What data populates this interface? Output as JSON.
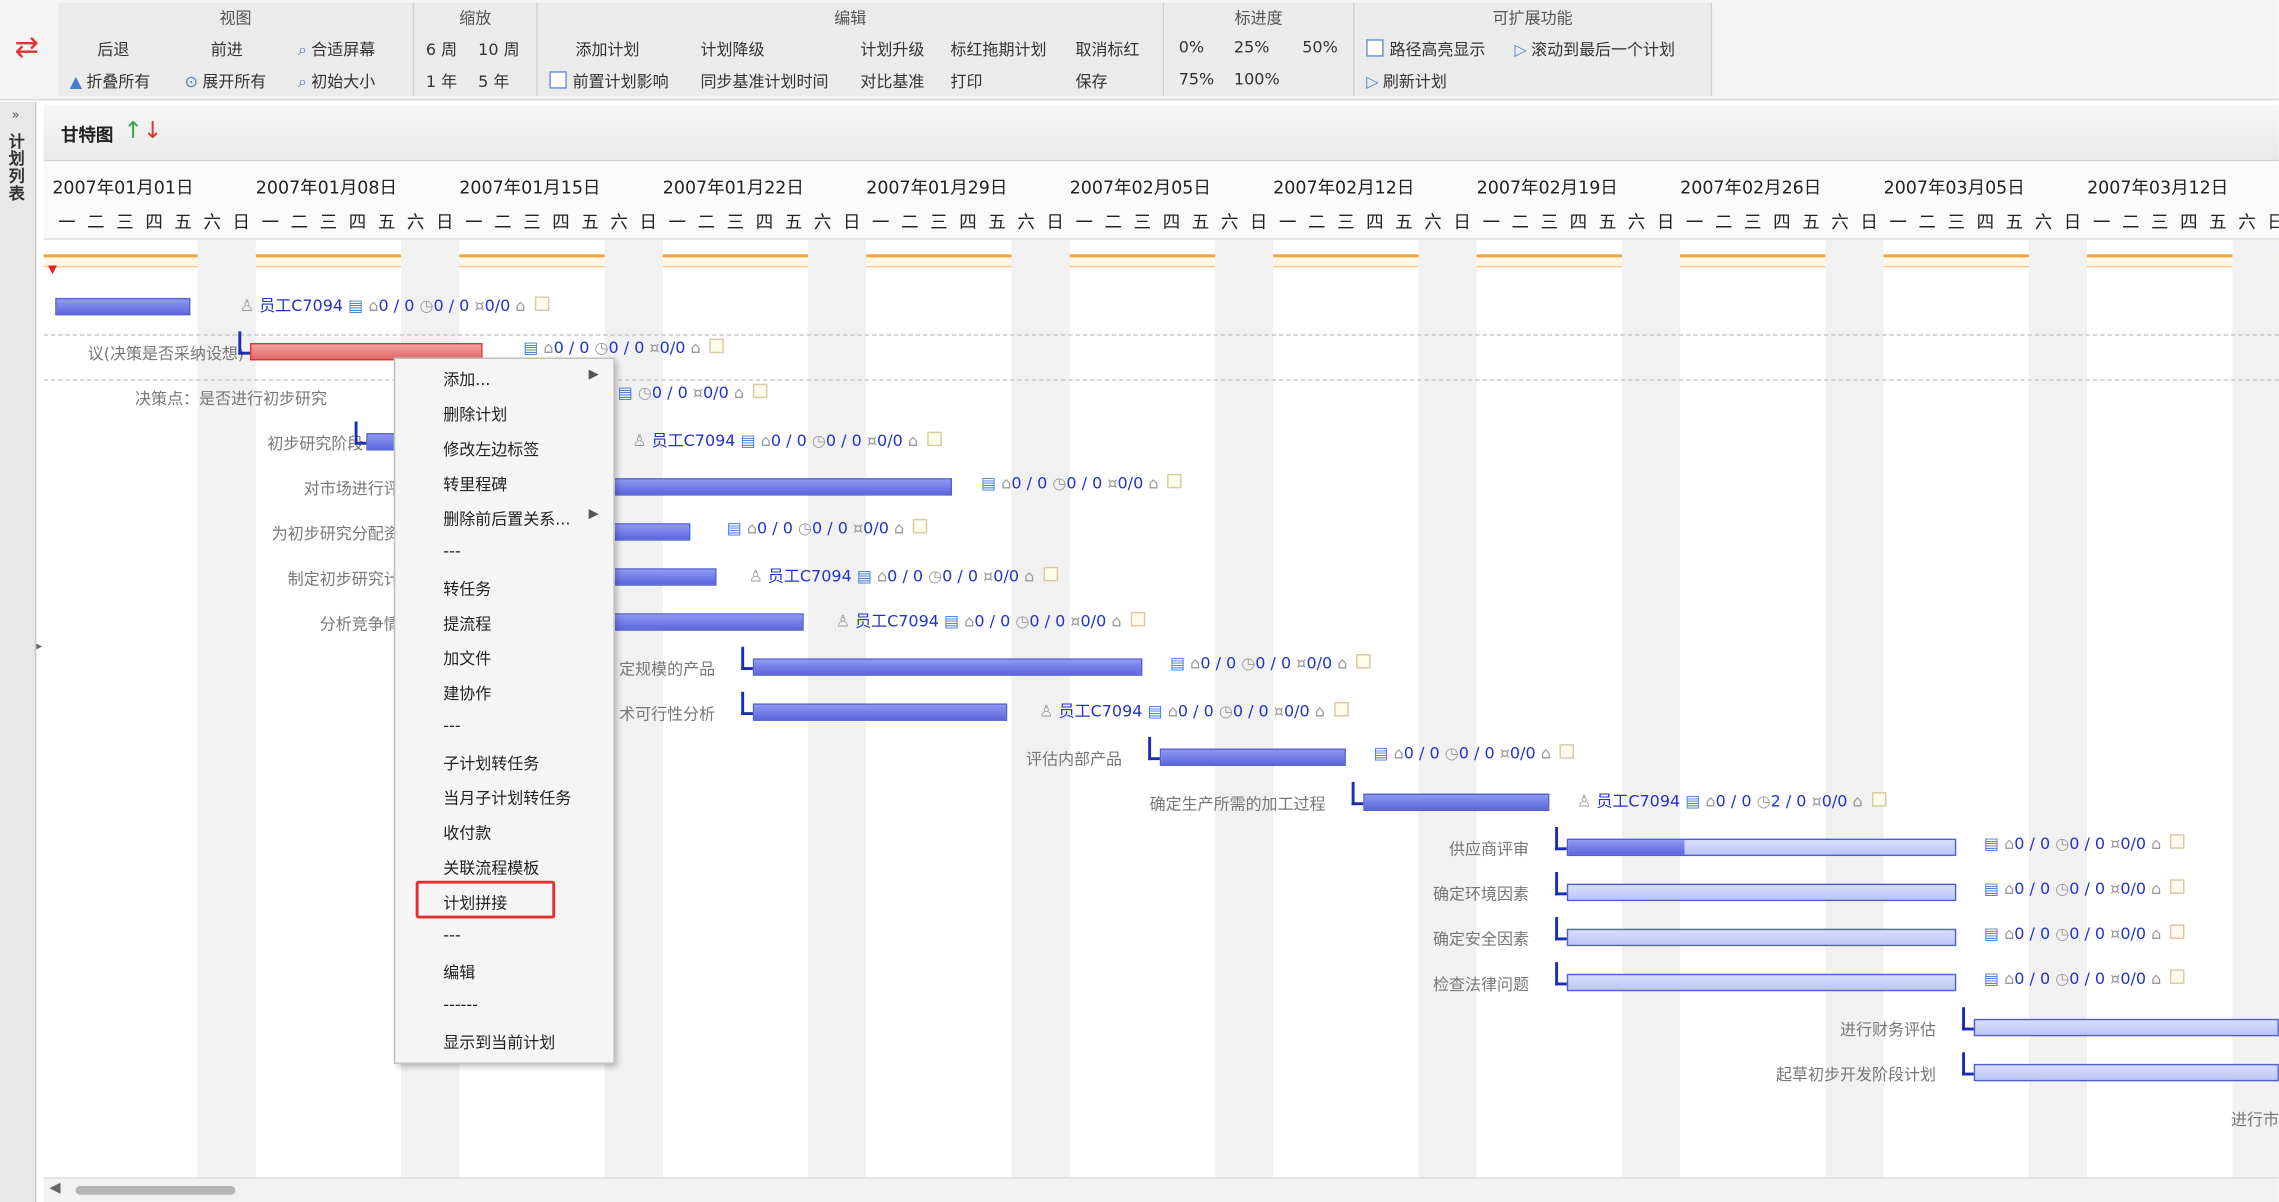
{
  "toolbar": {
    "groups": {
      "view": "视图",
      "zoom": "缩放",
      "edit": "编辑",
      "progress": "标进度",
      "ext": "可扩展功能"
    },
    "view": {
      "back": "后退",
      "forward": "前进",
      "fit": "合适屏幕",
      "collapse": "折叠所有",
      "expand": "展开所有",
      "init": "初始大小"
    },
    "zoom": {
      "w6": "6 周",
      "w10": "10 周",
      "y1": "1 年",
      "y5": "5 年"
    },
    "edit": {
      "add": "添加计划",
      "demote": "计划降级",
      "upgrade": "计划升级",
      "drag": "标红拖期计划",
      "unmark": "取消标红",
      "prev_effect": "前置计划影响",
      "sync": "同步基准计划时间",
      "compare": "对比基准",
      "print": "打印",
      "save": "保存"
    },
    "progress": {
      "p0": "0%",
      "p25": "25%",
      "p50": "50%",
      "p75": "75%",
      "p100": "100%"
    },
    "ext": {
      "highlight": "路径高亮显示",
      "scroll_last": "滚动到最后一个计划",
      "refresh": "刷新计划"
    }
  },
  "side_tab": {
    "label": "计划列表"
  },
  "gantt": {
    "title": "甘特图",
    "dates": [
      "2007年01月01日",
      "2007年01月08日",
      "2007年01月15日",
      "2007年01月22日",
      "2007年01月29日",
      "2007年02月05日",
      "2007年02月12日",
      "2007年02月19日",
      "2007年02月26日",
      "2007年03月05日",
      "2007年03月12日"
    ],
    "weekdays": [
      "一",
      "二",
      "三",
      "四",
      "五",
      "六",
      "日"
    ]
  },
  "tasks": [
    {
      "label": "",
      "meta": {
        "user": "员工C7094",
        "a": "0 / 0",
        "b": "0 / 0",
        "c": "0/0"
      }
    },
    {
      "label": "议(决策是否采纳设想)",
      "meta": {
        "user": "",
        "a": "0 / 0",
        "b": "0 / 0",
        "c": "0/0"
      }
    },
    {
      "label": "决策点：是否进行初步研究",
      "meta": {
        "user": "",
        "a": "",
        "b": "0 / 0",
        "c": "0/0"
      }
    },
    {
      "label": "初步研究阶段",
      "meta": {
        "user": "员工C7094",
        "a": "0 / 0",
        "b": "0 / 0",
        "c": "0/0"
      }
    },
    {
      "label": "对市场进行评",
      "meta": {
        "user": "",
        "a": "0 / 0",
        "b": "0 / 0",
        "c": "0/0"
      }
    },
    {
      "label": "为初步研究分配资",
      "meta": {
        "user": "",
        "a": "0 / 0",
        "b": "0 / 0",
        "c": "0/0"
      }
    },
    {
      "label": "制定初步研究计",
      "meta": {
        "user": "员工C7094",
        "a": "0 / 0",
        "b": "0 / 0",
        "c": "0/0"
      }
    },
    {
      "label": "分析竞争情",
      "meta": {
        "user": "员工C7094",
        "a": "0 / 0",
        "b": "0 / 0",
        "c": "0/0"
      }
    },
    {
      "label": "定规模的产品",
      "meta": {
        "user": "",
        "a": "0 / 0",
        "b": "0 / 0",
        "c": "0/0"
      }
    },
    {
      "label": "术可行性分析",
      "meta": {
        "user": "员工C7094",
        "a": "0 / 0",
        "b": "0 / 0",
        "c": "0/0"
      }
    },
    {
      "label": "评估内部产品",
      "meta": {
        "user": "",
        "a": "0 / 0",
        "b": "0 / 0",
        "c": "0/0"
      }
    },
    {
      "label": "确定生产所需的加工过程",
      "meta": {
        "user": "员工C7094",
        "a": "0 / 0",
        "b": "2 / 0",
        "c": "0/0"
      }
    },
    {
      "label": "供应商评审",
      "meta": {
        "user": "",
        "a": "0 / 0",
        "b": "0 / 0",
        "c": "0/0"
      }
    },
    {
      "label": "确定环境因素",
      "meta": {
        "user": "",
        "a": "0 / 0",
        "b": "0 / 0",
        "c": "0/0"
      }
    },
    {
      "label": "确定安全因素",
      "meta": {
        "user": "",
        "a": "0 / 0",
        "b": "0 / 0",
        "c": "0/0"
      }
    },
    {
      "label": "检查法律问题",
      "meta": {
        "user": "",
        "a": "0 / 0",
        "b": "0 / 0",
        "c": "0/0"
      }
    },
    {
      "label": "进行财务评估",
      "meta": {
        "user": "",
        "a": "",
        "b": "",
        "c": ""
      }
    },
    {
      "label": "起草初步开发阶段计划",
      "meta": {
        "user": "",
        "a": "",
        "b": "",
        "c": ""
      }
    },
    {
      "label": "进行市",
      "meta": {
        "user": "",
        "a": "",
        "b": "",
        "c": ""
      }
    }
  ],
  "context_menu": {
    "items": [
      {
        "label": "添加...",
        "submenu": true
      },
      {
        "label": "删除计划",
        "submenu": false
      },
      {
        "label": "修改左边标签",
        "submenu": false
      },
      {
        "label": "转里程碑",
        "submenu": false
      },
      {
        "label": "删除前后置关系...",
        "submenu": true
      },
      {
        "label": "---",
        "submenu": false
      },
      {
        "label": "转任务",
        "submenu": false
      },
      {
        "label": "提流程",
        "submenu": false
      },
      {
        "label": "加文件",
        "submenu": false
      },
      {
        "label": "建协作",
        "submenu": false
      },
      {
        "label": "---",
        "submenu": false
      },
      {
        "label": "子计划转任务",
        "submenu": false
      },
      {
        "label": "当月子计划转任务",
        "submenu": false
      },
      {
        "label": "收付款",
        "submenu": false
      },
      {
        "label": "关联流程模板",
        "submenu": false
      },
      {
        "label": "计划拼接",
        "submenu": false
      },
      {
        "label": "---",
        "submenu": false
      },
      {
        "label": "编辑",
        "submenu": false
      },
      {
        "label": "------",
        "submenu": false
      },
      {
        "label": "显示到当前计划",
        "submenu": false
      }
    ],
    "highlighted": "计划拼接"
  },
  "colors": {
    "bar_border": "#4f5fd0",
    "bar_fill": "#6b76e2",
    "highlight": "#e03030",
    "today_line": "#f2a23a"
  }
}
